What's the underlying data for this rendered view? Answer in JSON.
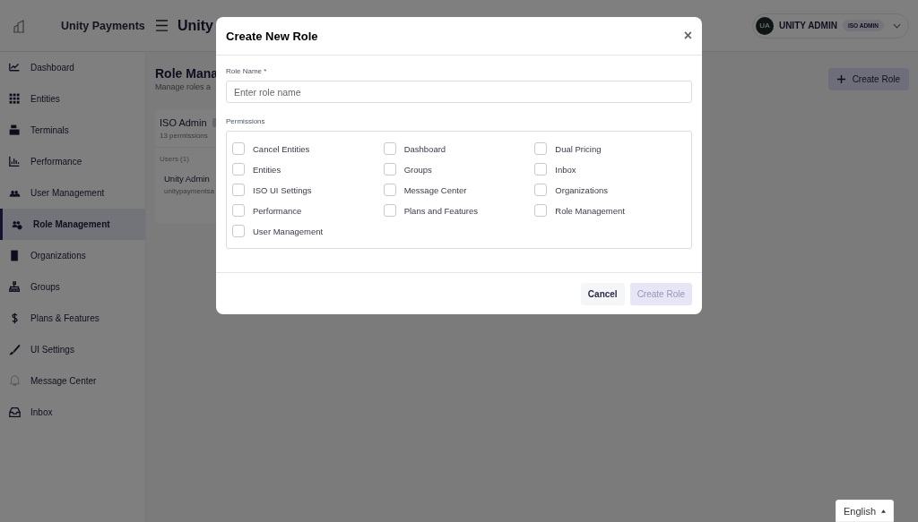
{
  "brand": {
    "name": "Unity Payments"
  },
  "header": {
    "title": "Unity",
    "user": {
      "initials": "UA",
      "name": "UNITY ADMIN",
      "role": "ISO ADMIN"
    }
  },
  "sidebar": {
    "items": [
      {
        "label": "Dashboard",
        "selected": false
      },
      {
        "label": "Entities",
        "selected": false
      },
      {
        "label": "Terminals",
        "selected": false
      },
      {
        "label": "Performance",
        "selected": false
      },
      {
        "label": "User Management",
        "selected": false
      },
      {
        "label": "Role Management",
        "selected": true
      },
      {
        "label": "Organizations",
        "selected": false
      },
      {
        "label": "Groups",
        "selected": false
      },
      {
        "label": "Plans & Features",
        "selected": false
      },
      {
        "label": "UI Settings",
        "selected": false
      },
      {
        "label": "Message Center",
        "selected": false
      },
      {
        "label": "Inbox",
        "selected": false
      }
    ]
  },
  "page": {
    "title": "Role Mana",
    "subtitle": "Manage roles a",
    "create_button": "Create Role",
    "role_card": {
      "name": "ISO Admin",
      "permissions": "13 permissions",
      "users_heading": "Users (1)",
      "user_name": "Unity Admin",
      "user_email": "unitypaymentsa"
    }
  },
  "dialog": {
    "title": "Create New Role",
    "close": "×",
    "role_name_label": "Role Name *",
    "role_name_placeholder": "Enter role name",
    "permissions_label": "Permissions",
    "permissions": [
      {
        "label": "Cancel Entities",
        "checked": false
      },
      {
        "label": "Dashboard",
        "checked": false
      },
      {
        "label": "Dual Pricing",
        "checked": false
      },
      {
        "label": "Entities",
        "checked": false
      },
      {
        "label": "Groups",
        "checked": false
      },
      {
        "label": "Inbox",
        "checked": false
      },
      {
        "label": "ISO UI Settings",
        "checked": false
      },
      {
        "label": "Message Center",
        "checked": false
      },
      {
        "label": "Organizations",
        "checked": false
      },
      {
        "label": "Performance",
        "checked": false
      },
      {
        "label": "Plans and Features",
        "checked": false
      },
      {
        "label": "Role Management",
        "checked": false
      },
      {
        "label": "User Management",
        "checked": false
      }
    ],
    "cancel": "Cancel",
    "submit": {
      "label": "Create Role",
      "disabled": true
    }
  },
  "language": {
    "label": "English"
  }
}
